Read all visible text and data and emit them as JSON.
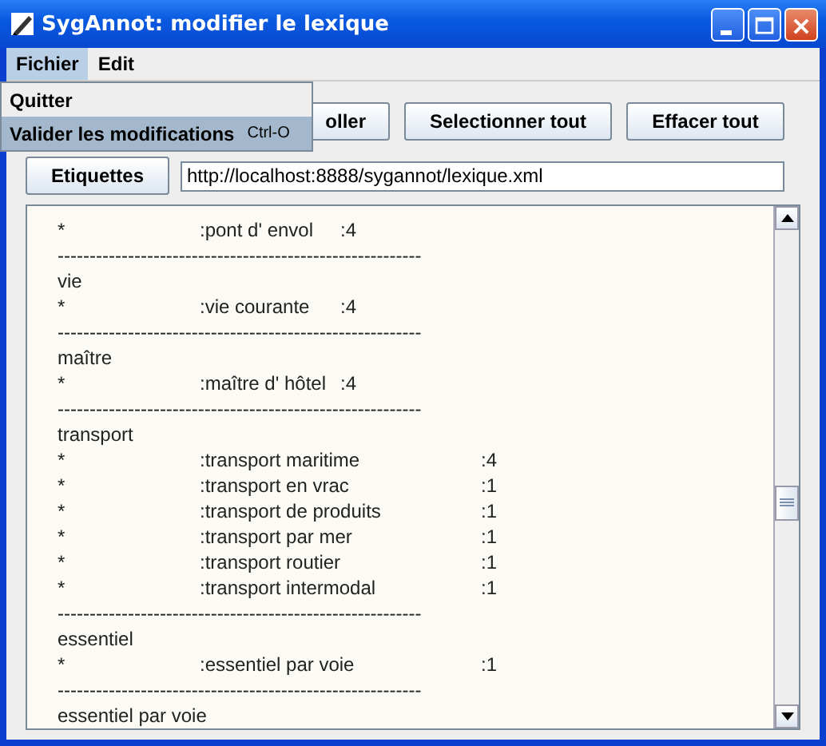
{
  "window": {
    "title": "SygAnnot: modifier le lexique"
  },
  "menu_bar": [
    {
      "label": "Fichier",
      "selected": true
    },
    {
      "label": "Edit",
      "selected": false
    }
  ],
  "open_menu": {
    "items": [
      {
        "label": "Quitter",
        "selected": false
      },
      {
        "label": "Valider les modifications",
        "shortcut": "Ctrl-O",
        "selected": true
      }
    ]
  },
  "toolbar": [
    "oller",
    "Selectionner tout",
    "Effacer tout"
  ],
  "etiquettes_button": "Etiquettes",
  "url_field": {
    "value": "http://localhost:8888/sygannot/lexique.xml"
  },
  "lexicon_lines": [
    {
      "kind": "entry",
      "marker": "*",
      "term": ":pont d' envol",
      "count": ":4"
    },
    {
      "kind": "rule",
      "text": "---------------------------------------------------------"
    },
    {
      "kind": "head",
      "text": "vie"
    },
    {
      "kind": "entry",
      "marker": "*",
      "term": ":vie courante",
      "count": ":4"
    },
    {
      "kind": "rule",
      "text": "---------------------------------------------------------"
    },
    {
      "kind": "head",
      "text": "maître"
    },
    {
      "kind": "entry",
      "marker": "*",
      "term": ":maître d' hôtel",
      "count": ":4"
    },
    {
      "kind": "rule",
      "text": "---------------------------------------------------------"
    },
    {
      "kind": "head",
      "text": "transport"
    },
    {
      "kind": "entry",
      "marker": "*",
      "term": ":transport maritime",
      "count": ":4"
    },
    {
      "kind": "entry",
      "marker": "*",
      "term": ":transport en vrac",
      "count": ":1"
    },
    {
      "kind": "entry",
      "marker": "*",
      "term": ":transport de produits",
      "count": ":1"
    },
    {
      "kind": "entry",
      "marker": "*",
      "term": ":transport par mer",
      "count": ":1"
    },
    {
      "kind": "entry",
      "marker": "*",
      "term": ":transport routier",
      "count": ":1"
    },
    {
      "kind": "entry",
      "marker": "*",
      "term": ":transport intermodal",
      "count": ":1"
    },
    {
      "kind": "rule",
      "text": "---------------------------------------------------------"
    },
    {
      "kind": "head",
      "text": "essentiel"
    },
    {
      "kind": "entry",
      "marker": "*",
      "term": ":essentiel par voie",
      "count": ":1"
    },
    {
      "kind": "rule",
      "text": "---------------------------------------------------------"
    },
    {
      "kind": "head",
      "text": "essentiel par voie"
    }
  ]
}
